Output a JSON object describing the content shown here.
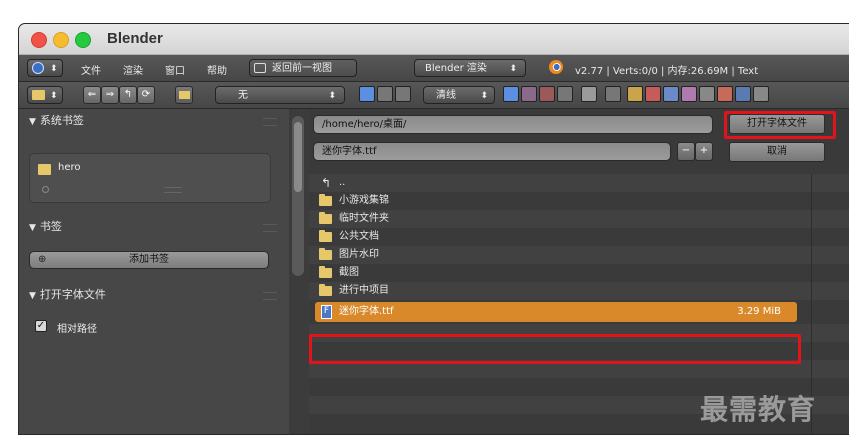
{
  "window": {
    "title": "Blender"
  },
  "header1": {
    "menus": [
      "文件",
      "渲染",
      "窗口",
      "帮助"
    ],
    "back_button": "返回前一视图",
    "render_engine": "Blender 渲染",
    "status": "v2.77 | Verts:0/0 | 内存:26.69M | Text"
  },
  "header2": {
    "display_mode": "无",
    "sort_mode": "清线"
  },
  "sidebar": {
    "system_bookmarks": {
      "title": "系统书签",
      "items": [
        "hero"
      ]
    },
    "bookmarks": {
      "title": "书签",
      "add_label": "添加书签"
    },
    "open_font": {
      "title": "打开字体文件",
      "relative_path_label": "相对路径",
      "relative_path_checked": true
    }
  },
  "file_browser": {
    "path": "/home/hero/桌面/",
    "filename": "迷你字体.ttf",
    "open_button": "打开字体文件",
    "cancel_button": "取消",
    "parent_dir": "..",
    "entries": [
      {
        "name": "小游戏集锦",
        "type": "folder"
      },
      {
        "name": "临时文件夹",
        "type": "folder"
      },
      {
        "name": "公共文档",
        "type": "folder"
      },
      {
        "name": "图片水印",
        "type": "folder"
      },
      {
        "name": "截图",
        "type": "folder"
      },
      {
        "name": "进行中项目",
        "type": "folder"
      },
      {
        "name": "迷你字体.ttf",
        "type": "font",
        "size": "3.29 MiB",
        "selected": true
      }
    ]
  },
  "watermark": "最需教育",
  "colors": {
    "selection": "#d9892a",
    "highlight_box": "#e1141a",
    "panel": "#474747"
  }
}
